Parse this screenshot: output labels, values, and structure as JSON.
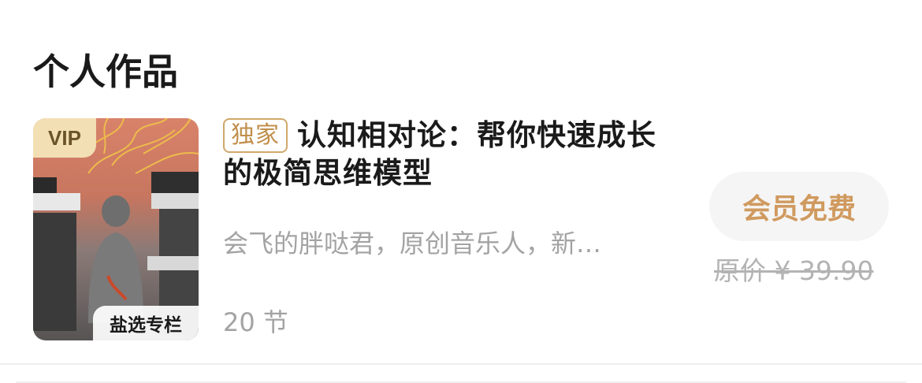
{
  "section": {
    "title": "个人作品"
  },
  "work": {
    "cover": {
      "vip_label": "VIP",
      "column_label": "盐选专栏"
    },
    "exclusive_tag": "独家",
    "title": "认知相对论：帮你快速成长的极简思维模型",
    "author_desc": "会飞的胖哒君，原创音乐人，新…",
    "lessons": "20 节",
    "member_button": "会员免费",
    "original_price": "原价 ¥ 39.90"
  },
  "colors": {
    "accent_gold": "#d09a5f",
    "tag_border": "#d0a86a",
    "vip_bg": "#f2dfb4",
    "muted_text": "#a3a3a3"
  }
}
